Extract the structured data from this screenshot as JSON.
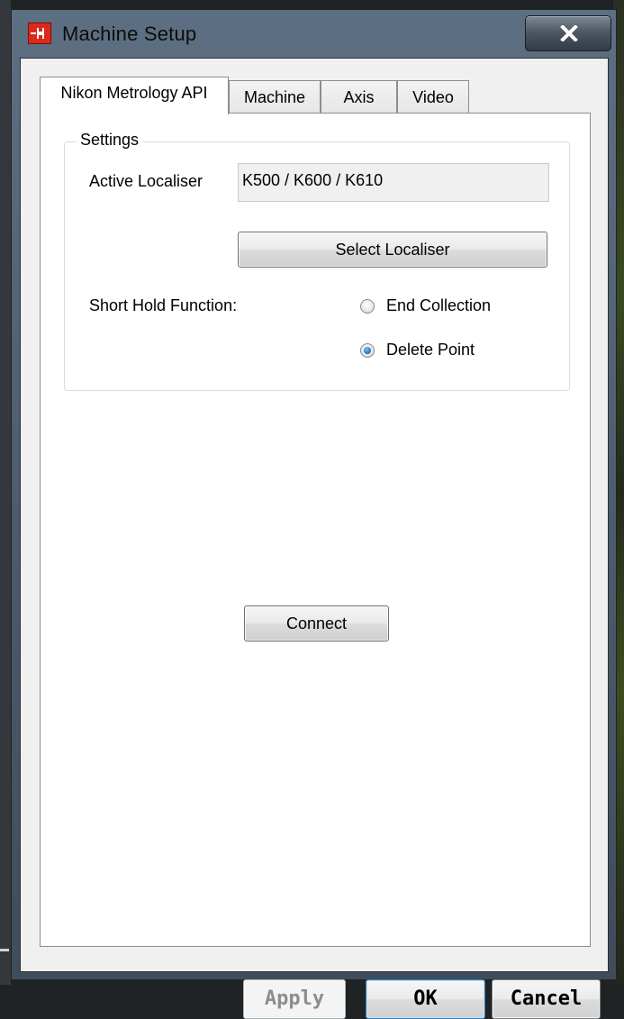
{
  "window": {
    "title": "Machine Setup"
  },
  "tabs": [
    {
      "label": "Nikon Metrology API",
      "active": true
    },
    {
      "label": "Machine",
      "active": false
    },
    {
      "label": "Axis",
      "active": false
    },
    {
      "label": "Video",
      "active": false
    }
  ],
  "settings": {
    "group_title": "Settings",
    "active_localiser_label": "Active Localiser",
    "active_localiser_value": "K500 / K600 / K610",
    "select_localiser_label": "Select Localiser",
    "short_hold_label": "Short Hold Function:",
    "options": [
      {
        "label": "End Collection",
        "checked": false
      },
      {
        "label": "Delete Point",
        "checked": true
      }
    ]
  },
  "connect_label": "Connect",
  "footer": {
    "apply_label": "Apply",
    "ok_label": "OK",
    "cancel_label": "Cancel"
  },
  "icons": {
    "app": "machine-setup-app-icon",
    "close": "close-icon"
  }
}
